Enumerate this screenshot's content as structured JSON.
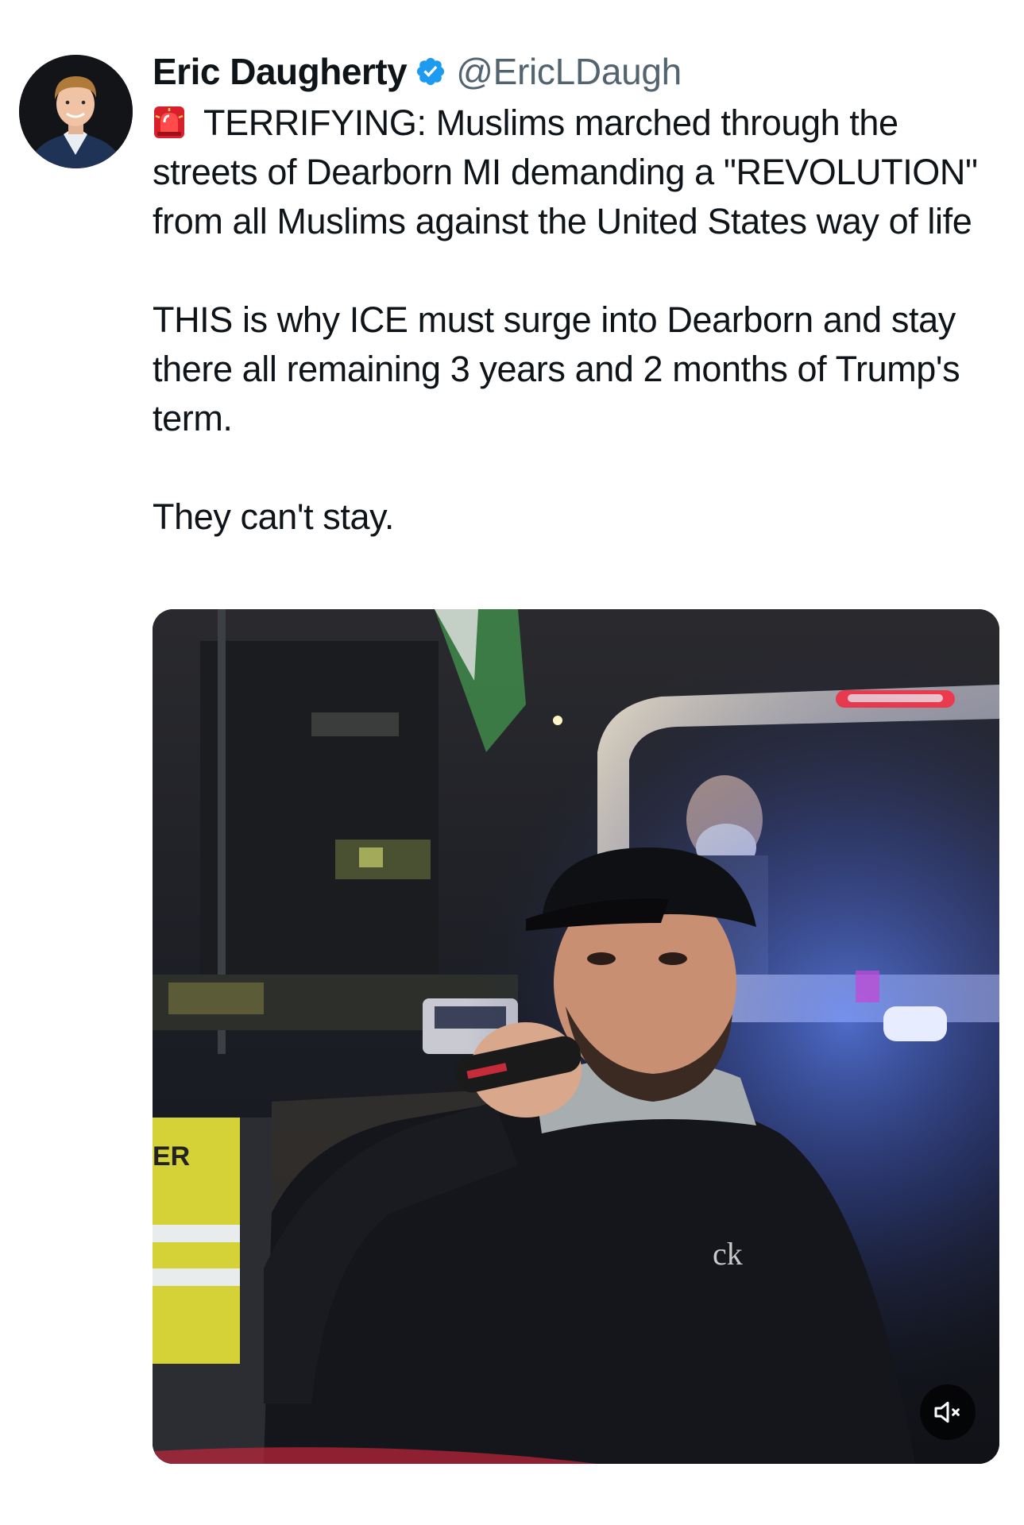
{
  "author": {
    "display_name": "Eric Daugherty",
    "handle": "@EricLDaugh",
    "verified": true,
    "verified_color": "#1d9bf0"
  },
  "tweet": {
    "paragraphs": [
      "TERRIFYING: Muslims marched through the streets of Dearborn MI demanding a \"REVOLUTION\" from all Muslims against the United States way of life",
      "THIS is why ICE must surge into Dearborn and stay there all remaining 3 years and 2 months of Trump's term.",
      "They can't stay."
    ],
    "leading_emoji": "rotating-light-icon"
  },
  "media": {
    "type": "video",
    "vest_text": "ER",
    "shirt_logo": "ck",
    "muted": true,
    "mute_icon": "speaker-muted-icon"
  },
  "colors": {
    "text": "#0f1419",
    "handle": "#536471",
    "siren_red": "#e0245e"
  }
}
